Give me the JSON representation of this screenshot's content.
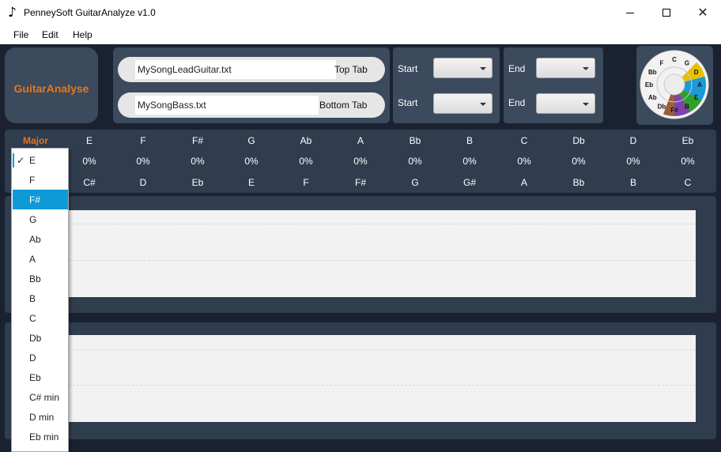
{
  "window": {
    "title": "PenneySoft GuitarAnalyze v1.0",
    "icon": "music-note-icon"
  },
  "menu": [
    "File",
    "Edit",
    "Help"
  ],
  "logo": {
    "text": "GuitarAnalyse",
    "color": "#e8751a"
  },
  "files": {
    "top": {
      "value": "MySongLeadGuitar.txt",
      "label": "Top Tab"
    },
    "bottom": {
      "value": "MySongBass.txt",
      "label": "Bottom Tab"
    }
  },
  "range": {
    "start_label": "Start",
    "end_label": "End"
  },
  "circle_of_fifths": {
    "outer": [
      "C",
      "G",
      "D",
      "A",
      "E",
      "B",
      "F#",
      "Db",
      "Ab",
      "Eb",
      "Bb",
      "F"
    ],
    "highlight_colors": [
      "#1a9ad6",
      "#2ca02c",
      "#7030a0",
      "#8b4513",
      "#e8c000"
    ]
  },
  "key_table": {
    "mode": "Major",
    "headers": [
      "E",
      "F",
      "F#",
      "G",
      "Ab",
      "A",
      "Bb",
      "B",
      "C",
      "Db",
      "D",
      "Eb"
    ],
    "percentages": [
      "0%",
      "0%",
      "0%",
      "0%",
      "0%",
      "0%",
      "0%",
      "0%",
      "0%",
      "0%",
      "0%",
      "0%"
    ],
    "relatives": [
      "C#",
      "D",
      "Eb",
      "E",
      "F",
      "F#",
      "G",
      "G#",
      "A",
      "Bb",
      "B",
      "C"
    ]
  },
  "dropdown": {
    "checked": "E",
    "highlighted": "F#",
    "items": [
      "E",
      "F",
      "F#",
      "G",
      "Ab",
      "A",
      "Bb",
      "B",
      "C",
      "Db",
      "D",
      "Eb",
      "C# min",
      "D min",
      "Eb min"
    ],
    "check_mark": "✓"
  },
  "colors": {
    "accent": "#e8751a",
    "selection": "#0e9ad6",
    "background": "#1a2231",
    "panel": "#3b4a5c"
  }
}
